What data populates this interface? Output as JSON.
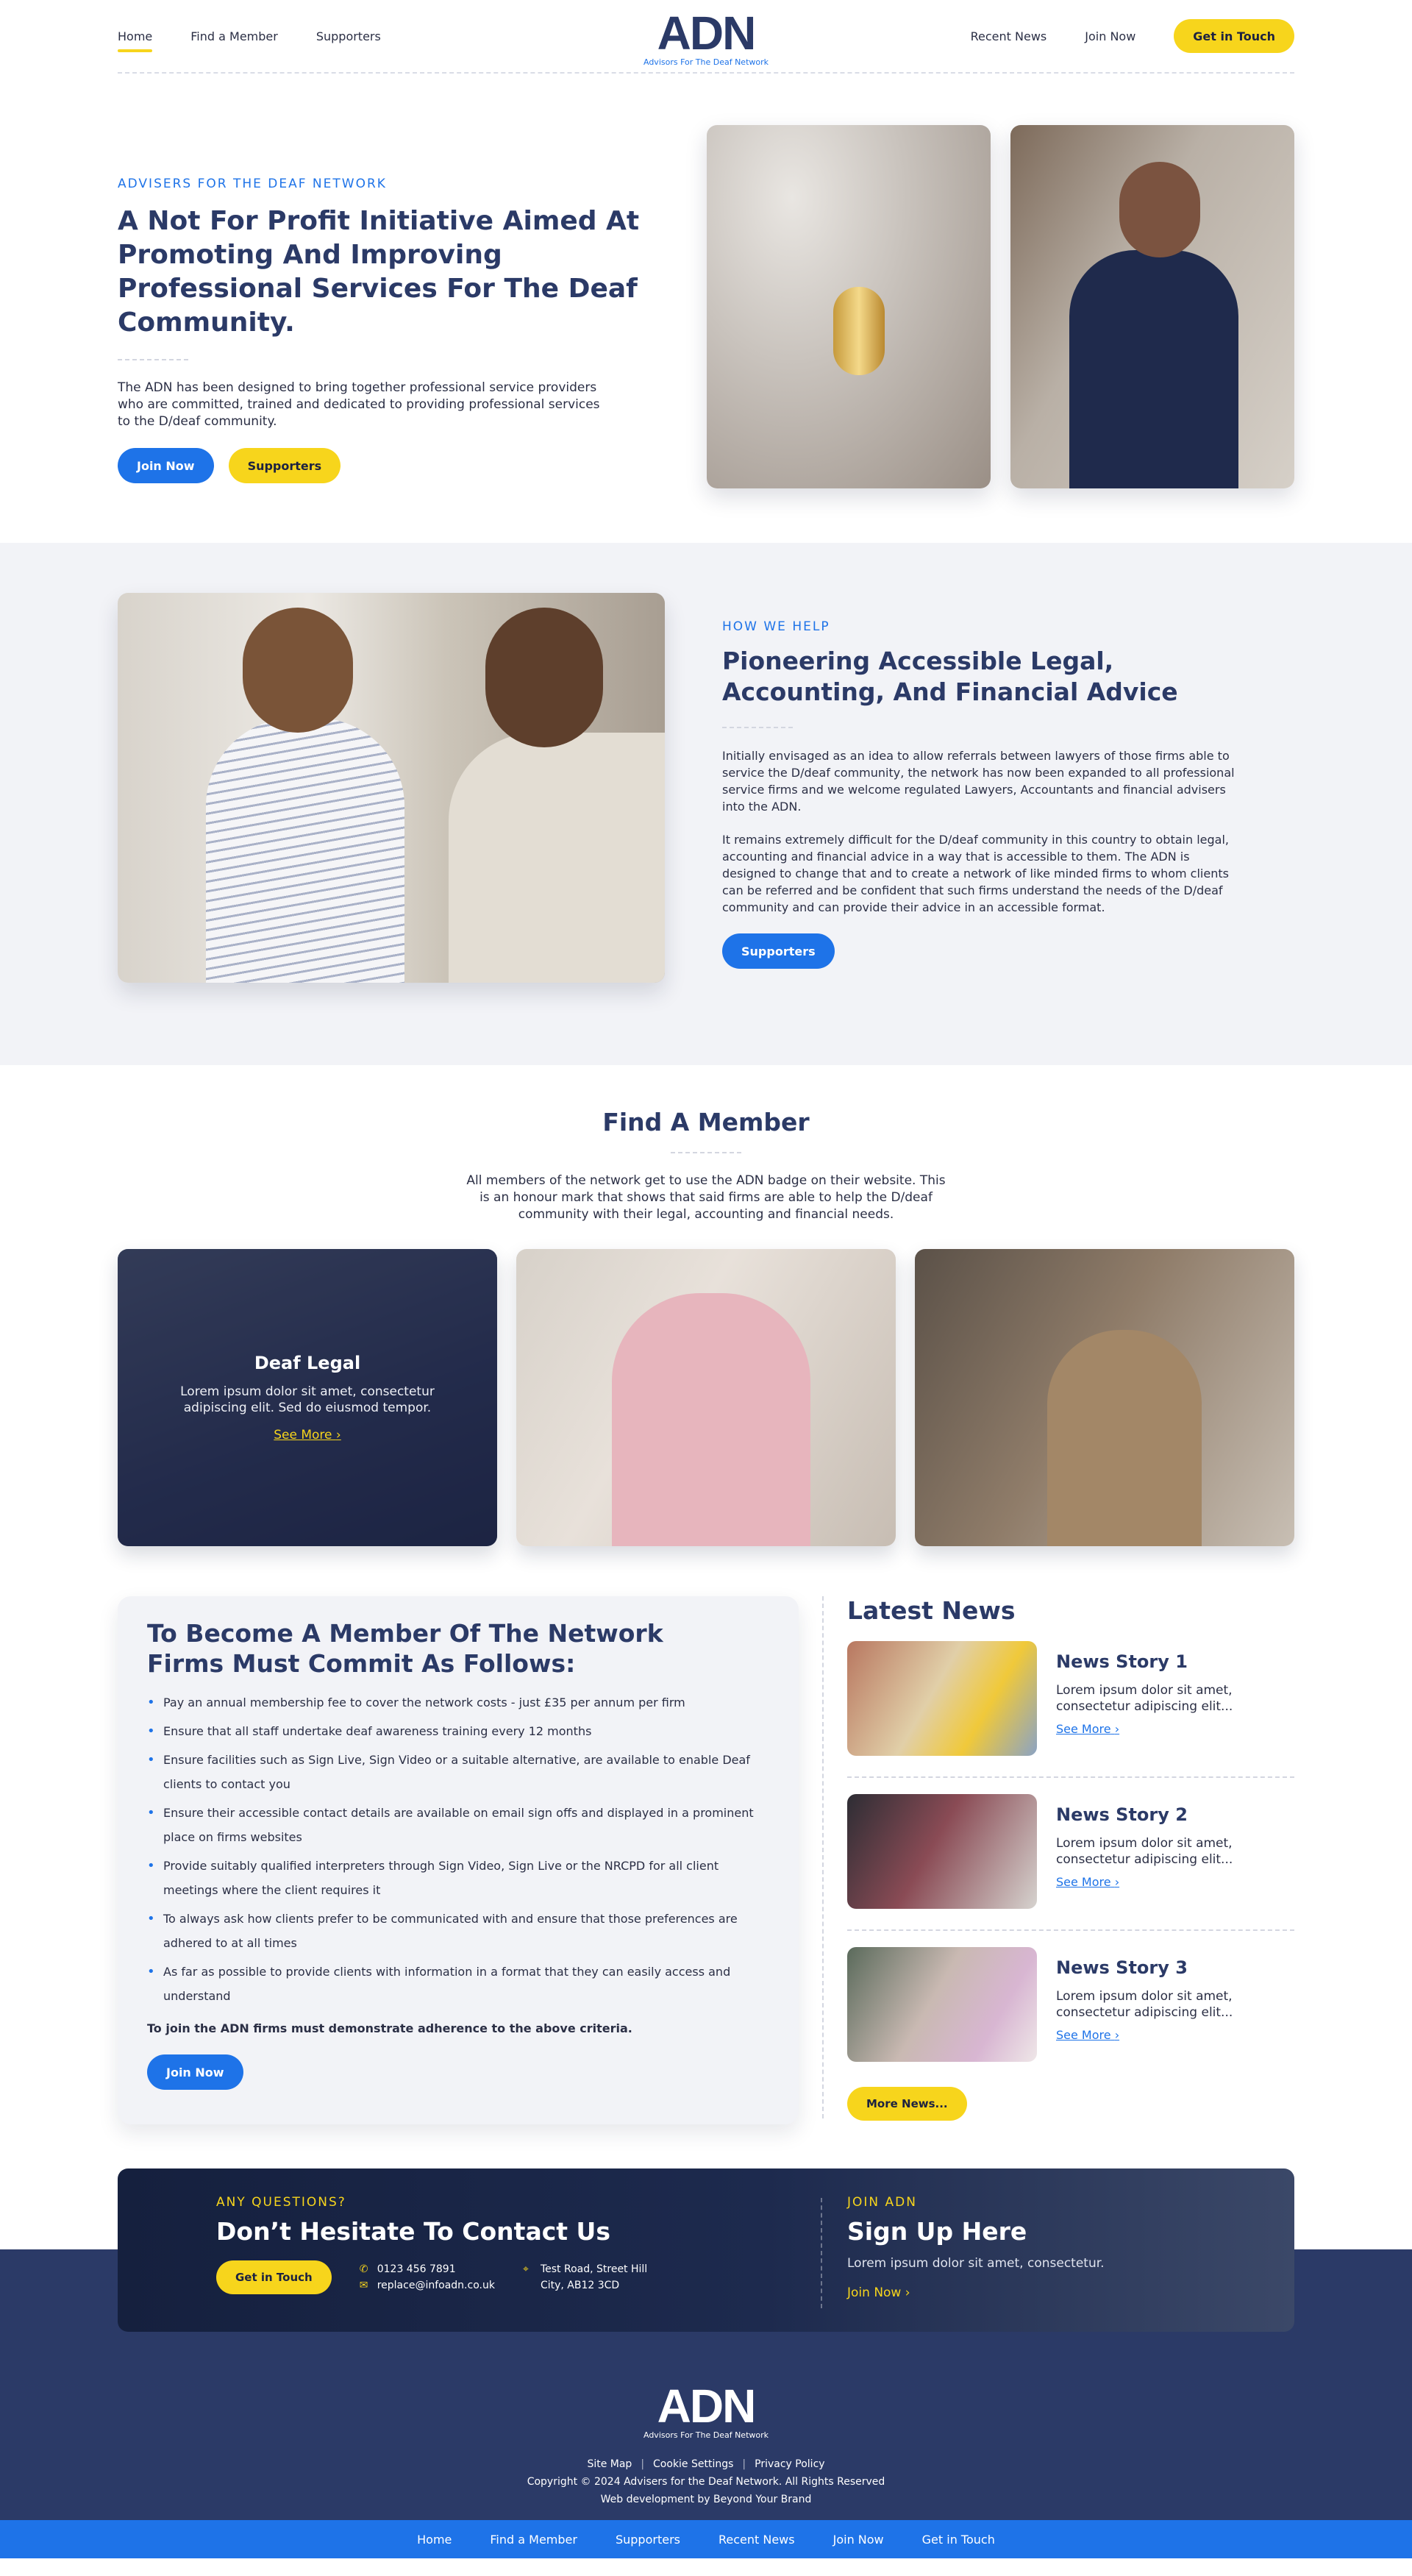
{
  "header": {
    "nav_left": [
      "Home",
      "Find  a Member",
      "Supporters"
    ],
    "logo": "ADN",
    "logo_tagline": "Advisors For The Deaf Network",
    "nav_right": [
      "Recent News",
      "Join Now"
    ],
    "cta": "Get in Touch"
  },
  "hero": {
    "eyebrow": "ADVISERS FOR THE DEAF NETWORK",
    "title": "A Not For Profit Initiative Aimed At Promoting And Improving Professional Services For The Deaf Community.",
    "body": "The ADN has been designed to bring together professional service providers who are committed, trained and dedicated to providing professional services to the D/deaf community.",
    "btn_join": "Join Now",
    "btn_supporters": "Supporters"
  },
  "help": {
    "eyebrow": "HOW WE HELP",
    "title": "Pioneering Accessible Legal, Accounting, And Financial Advice",
    "p1": "Initially envisaged as an idea to allow referrals between lawyers of those firms able to service the D/deaf community, the network has now been expanded to all professional service firms and we welcome regulated Lawyers, Accountants and financial advisers into the ADN.",
    "p2": "It remains extremely difficult for the D/deaf community in this country to obtain legal, accounting and financial advice in a way that is accessible to them. The ADN is designed to change that and to create a network of like minded firms to whom clients can be referred and be confident that such firms understand the needs of the D/deaf community and can provide their advice in an accessible format.",
    "btn": "Supporters"
  },
  "find": {
    "title": "Find A Member",
    "intro": "All members of the network get to use the ADN badge on their website. This is an honour mark that shows that said firms are able to help the D/deaf community with their legal, accounting and financial needs.",
    "card1": {
      "title": "Deaf Legal",
      "desc": "Lorem ipsum dolor sit amet, consectetur adipiscing elit. Sed do eiusmod tempor.",
      "more": "See More"
    }
  },
  "commit": {
    "title": "To Become A Member Of The Network Firms Must Commit As Follows:",
    "items": [
      "Pay an annual membership fee to cover the network costs - just £35 per annum per firm",
      "Ensure that all staff undertake deaf awareness training every 12 months",
      "Ensure facilities such as Sign Live, Sign Video or a suitable alternative, are available to enable Deaf clients to contact you",
      "Ensure their accessible contact details are available on email sign offs and displayed in a prominent place on firms websites",
      "Provide suitably qualified interpreters through Sign Video, Sign Live or the NRCPD for all client meetings where the client requires it",
      "To always ask how clients prefer to be communicated with and ensure that those preferences are adhered to at all times",
      "As far as possible to provide clients with information in a format that they can easily access and understand"
    ],
    "requirement": "To join the ADN firms must demonstrate adherence to the above criteria.",
    "btn": "Join Now"
  },
  "news": {
    "title": "Latest News",
    "stories": [
      {
        "title": "News Story 1",
        "desc": "Lorem ipsum dolor sit amet, consectetur adipiscing elit...",
        "more": "See More"
      },
      {
        "title": "News Story 2",
        "desc": "Lorem ipsum dolor sit amet, consectetur adipiscing elit...",
        "more": "See More"
      },
      {
        "title": "News Story 3",
        "desc": "Lorem ipsum dolor sit amet, consectetur adipiscing elit...",
        "more": "See More"
      }
    ],
    "more_btn": "More News..."
  },
  "contact": {
    "eyebrow": "ANY QUESTIONS?",
    "title": "Don’t Hesitate To Contact Us",
    "btn": "Get in Touch",
    "phone": "0123 456 7891",
    "email": "replace@infoadn.co.uk",
    "address1": "Test Road, Street Hill",
    "address2": "City, AB12 3CD",
    "join_eyebrow": "JOIN ADN",
    "join_title": "Sign Up Here",
    "join_desc": "Lorem ipsum dolor sit amet, consectetur.",
    "join_link": "Join Now"
  },
  "footer": {
    "logo": "ADN",
    "logo_tagline": "Advisors For The Deaf Network",
    "links": [
      "Site Map",
      "Cookie Settings",
      "Privacy Policy"
    ],
    "copyright": "Copyright © 2024 Advisers for the Deaf Network. All Rights Reserved",
    "dev": "Web development by Beyond Your Brand",
    "bottom_nav": [
      "Home",
      "Find  a Member",
      "Supporters",
      "Recent News",
      "Join Now",
      "Get in Touch"
    ]
  }
}
